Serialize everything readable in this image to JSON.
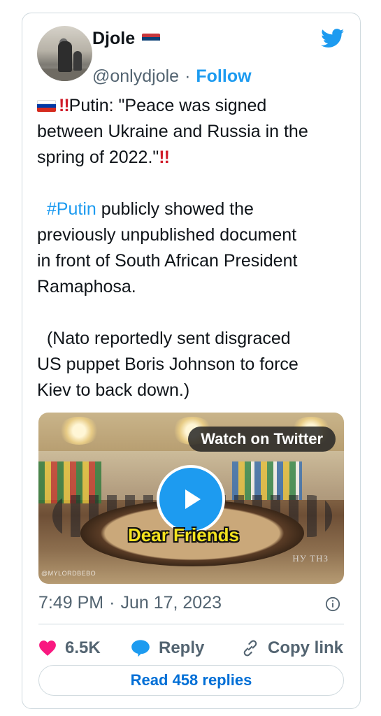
{
  "user": {
    "name": "Djole",
    "handle": "@onlydjole",
    "separator": "·",
    "follow_label": "Follow"
  },
  "tweet": {
    "line1": "Putin: \"Peace was signed",
    "line2": "between Ukraine and Russia in the",
    "line3": "spring of 2022.\"",
    "bangs": "!!",
    "hashtag": "#Putin",
    "line4_rest": " publicly showed the",
    "line5": "previously unpublished document",
    "line6": "in front of South African President",
    "line7": "Ramaphosa.",
    "line8": "  (Nato reportedly sent disgraced",
    "line9": "US puppet Boris Johnson to force",
    "line10": "Kiev to back down.)"
  },
  "media": {
    "watch_label": "Watch on Twitter",
    "caption": "Dear Friends",
    "watermark": "@MYLORDBEBO",
    "channel_logo": "НУ ТНЗ"
  },
  "meta": {
    "time": "7:49 PM",
    "separator": "·",
    "date": "Jun 17, 2023"
  },
  "actions": {
    "like_count": "6.5K",
    "reply_label": "Reply",
    "copy_label": "Copy link",
    "read_replies_label": "Read 458 replies"
  },
  "colors": {
    "accent": "#1d9bf0",
    "like": "#f91880",
    "muted": "#536471",
    "border": "#cfd9de"
  },
  "icons": [
    "twitter-bird-icon",
    "serbia-flag-icon",
    "russia-flag-icon",
    "play-icon",
    "info-icon",
    "heart-icon",
    "reply-bubble-icon",
    "link-icon"
  ]
}
